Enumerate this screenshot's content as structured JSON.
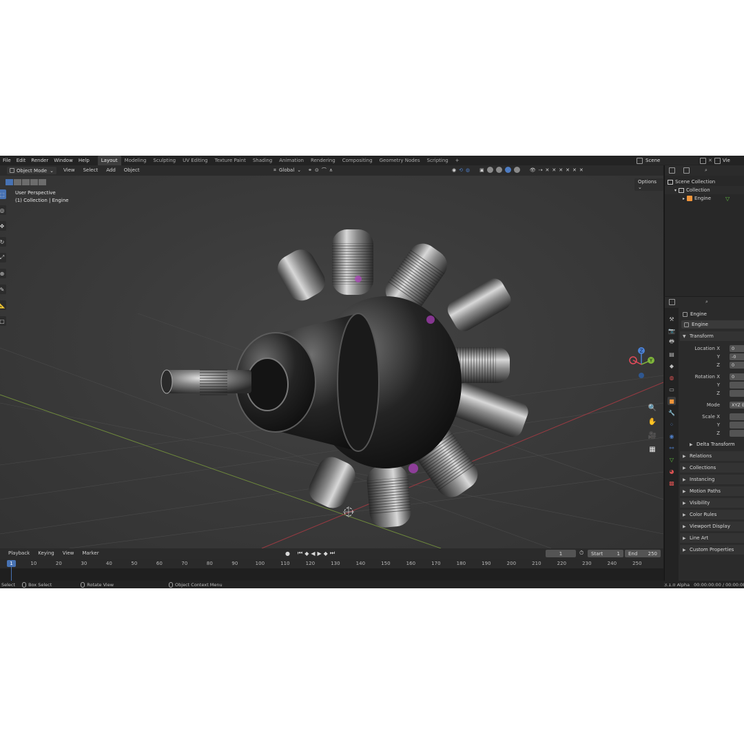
{
  "topbar": {
    "menus": [
      "File",
      "Edit",
      "Render",
      "Window",
      "Help"
    ],
    "workspaces": [
      "Layout",
      "Modeling",
      "Sculpting",
      "UV Editing",
      "Texture Paint",
      "Shading",
      "Animation",
      "Rendering",
      "Compositing",
      "Geometry Nodes",
      "Scripting",
      "+"
    ],
    "active_workspace": "Layout",
    "scene": "Scene",
    "view_layer": "Vie"
  },
  "viewport_header": {
    "mode": "Object Mode",
    "menus": [
      "View",
      "Select",
      "Add",
      "Object"
    ],
    "orientation": "Global",
    "options": "Options"
  },
  "viewport": {
    "perspective": "User Perspective",
    "collection_info": "(1) Collection | Engine"
  },
  "gizmo": {
    "z": "Z",
    "y": "Y",
    "x_color": "#e34b5a",
    "y_color": "#7fb53b",
    "z_color": "#4c82d4"
  },
  "timeline": {
    "menus": [
      "Playback",
      "Keying",
      "View",
      "Marker"
    ],
    "current_frame": "1",
    "start_label": "Start",
    "start": "1",
    "end_label": "End",
    "end": "250",
    "ticks": [
      "10",
      "20",
      "30",
      "40",
      "50",
      "60",
      "70",
      "80",
      "90",
      "100",
      "110",
      "120",
      "130",
      "140",
      "150",
      "160",
      "170",
      "180",
      "190",
      "200",
      "210",
      "220",
      "230",
      "240",
      "250"
    ]
  },
  "statusbar": {
    "items": [
      "Select",
      "Box Select",
      "Rotate View",
      "Object Context Menu"
    ],
    "version": "3.1.0 Alpha",
    "time": "00:00:00:00 / 00:00:08"
  },
  "outliner": {
    "scene_collection": "Scene Collection",
    "collection": "Collection",
    "object": "Engine"
  },
  "properties": {
    "object_name": "Engine",
    "object_field": "Engine",
    "transform": "Transform",
    "location_x": "Location X",
    "y": "Y",
    "z": "Z",
    "rotation_x": "Rotation X",
    "mode_label": "Mode",
    "mode_value": "XYZ E",
    "scale_x": "Scale X",
    "loc_vals": [
      "0",
      "-0",
      "0"
    ],
    "rot_vals": [
      "0",
      "",
      ""
    ],
    "delta_transform": "Delta Transform",
    "panels": [
      "Relations",
      "Collections",
      "Instancing",
      "Motion Paths",
      "Visibility",
      "Color Rules",
      "Viewport Display",
      "Line Art",
      "Custom Properties"
    ]
  }
}
